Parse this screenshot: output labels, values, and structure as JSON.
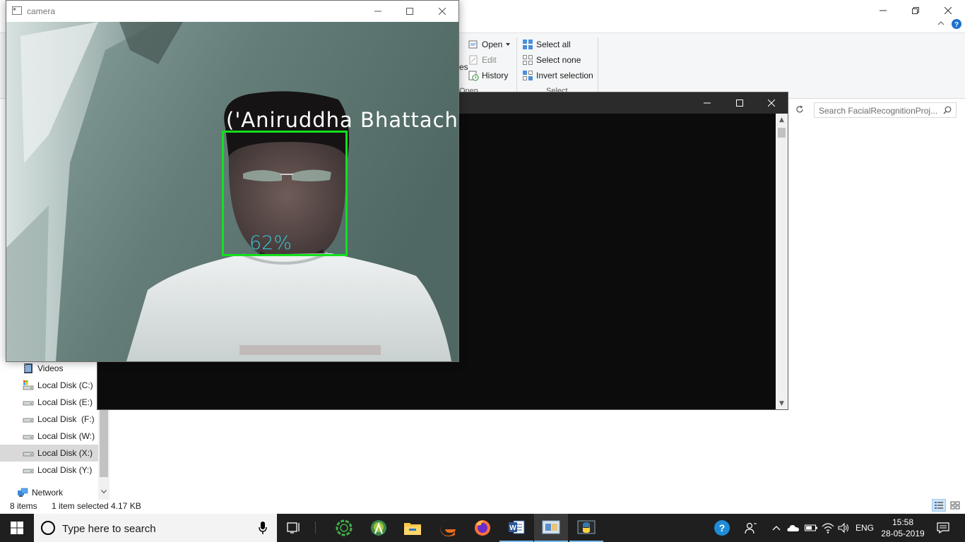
{
  "explorer": {
    "ribbon": {
      "open_group": {
        "open_label": "Open",
        "edit_label": "Edit",
        "history_label": "History",
        "group_label": "Open",
        "partial_left_text": "es"
      },
      "select_group": {
        "select_all_label": "Select all",
        "select_none_label": "Select none",
        "invert_selection_label": "Invert selection",
        "group_label": "Select"
      }
    },
    "search": {
      "placeholder": "Search FacialRecognitionProj..."
    },
    "nav": {
      "items": [
        {
          "label": "Videos",
          "icon": "videos-folder-icon"
        },
        {
          "label": "Local Disk (C:)",
          "icon": "system-drive-icon"
        },
        {
          "label": "Local Disk (E:)",
          "icon": "drive-icon"
        },
        {
          "label": "Local Disk  (F:)",
          "icon": "drive-icon"
        },
        {
          "label": "Local Disk (W:)",
          "icon": "drive-icon"
        },
        {
          "label": "Local Disk (X:)",
          "icon": "drive-icon",
          "selected": true
        },
        {
          "label": "Local Disk (Y:)",
          "icon": "drive-icon"
        }
      ],
      "network_label": "Network"
    },
    "status": {
      "item_count": "8 items",
      "selection": "1 item selected",
      "size": "4.17 KB"
    }
  },
  "camera_window": {
    "title": "camera",
    "recognition": {
      "name_text": "('Aniruddha Bhattach",
      "confidence_text": "62%"
    },
    "colors": {
      "box": "#14e01e",
      "confidence_text": "#34c6d8",
      "name_text": "#ffffff"
    }
  },
  "console_window": {
    "title": ""
  },
  "taskbar": {
    "search_placeholder": "Type here to search",
    "apps": [
      "task-view-icon",
      "anaconda-navigator-icon",
      "android-studio-icon",
      "file-explorer-icon",
      "edge-icon",
      "firefox-icon",
      "word-icon",
      "camera-app-icon",
      "python-icon"
    ],
    "tray": {
      "language": "ENG",
      "time": "15:58",
      "date": "28-05-2019"
    }
  }
}
